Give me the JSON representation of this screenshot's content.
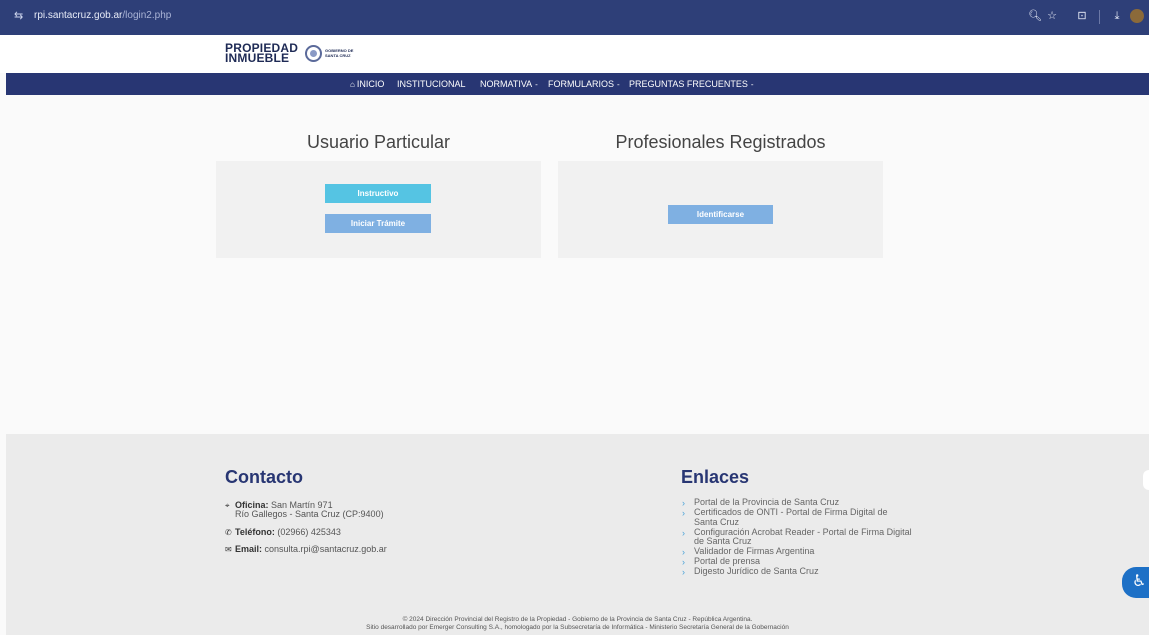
{
  "browser": {
    "url_host": "rpi.santacruz.gob.ar",
    "url_path": "/login2.php",
    "icons": [
      "site-settings-icon",
      "zoom-icon",
      "bookmark-star-icon",
      "extensions-icon",
      "download-icon",
      "profile-avatar"
    ]
  },
  "header": {
    "logo_line1": "PROPIEDAD",
    "logo_line2": "INMUEBLE",
    "gov_line1": "GOBIERNO DE",
    "gov_line2": "SANTA CRUZ"
  },
  "nav": {
    "inicio": "INICIO",
    "institucional": "INSTITUCIONAL",
    "normativa": "NORMATIVA",
    "formularios": "FORMULARIOS",
    "preguntas": "PREGUNTAS FRECUENTES",
    "caret": "-"
  },
  "main": {
    "particular_title": "Usuario Particular",
    "profesionales_title": "Profesionales Registrados",
    "instructivo": "Instructivo",
    "iniciar_tramite": "Iniciar Trámite",
    "identificarse": "Identificarse"
  },
  "footer": {
    "contacto_title": "Contacto",
    "oficina_label": "Oficina:",
    "oficina_line1": "San Martín 971",
    "oficina_line2": "Río Gallegos - Santa Cruz (CP:9400)",
    "telefono_label": "Teléfono:",
    "telefono_value": "(02966) 425343",
    "email_label": "Email:",
    "email_value": "consulta.rpi@santacruz.gob.ar",
    "enlaces_title": "Enlaces",
    "links": [
      "Portal de la Provincia de Santa Cruz",
      "Certificados de ONTI - Portal de Firma Digital de Santa Cruz",
      "Configuración Acrobat Reader - Portal de Firma Digital de Santa Cruz",
      "Validador de Firmas Argentina",
      "Portal de prensa",
      "Digesto Jurídico de Santa Cruz"
    ],
    "copyright_1": "© 2024 Dirección Provincial del Registro de la Propiedad - Gobierno de la Provincia de Santa Cruz - República Argentina.",
    "copyright_2": "Sitio desarrollado por Emerger Consulting S.A., homologado por la Subsecretaría de Informática - Ministerio Secretaría General de la Gobernación"
  },
  "colors": {
    "browser_bar": "#2e3f78",
    "nav_bar": "#283673",
    "btn_cyan": "#55c4e3",
    "btn_blue": "#7fb0e2",
    "accessibility": "#1d70c6"
  }
}
